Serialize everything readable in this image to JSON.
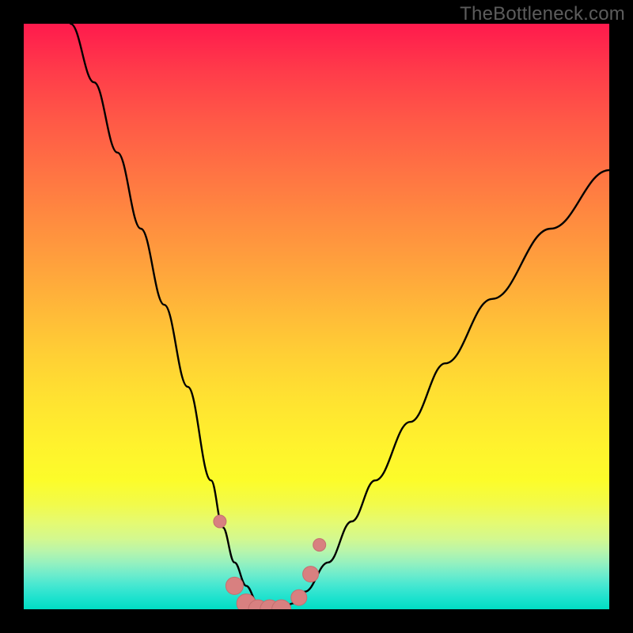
{
  "watermark": {
    "text": "TheBottleneck.com"
  },
  "colors": {
    "frame_bg": "#000000",
    "curve": "#000000",
    "marker_fill": "#d88080",
    "marker_stroke": "#c46f6f"
  },
  "chart_data": {
    "type": "line",
    "title": "",
    "xlabel": "",
    "ylabel": "",
    "xlim": [
      0,
      100
    ],
    "ylim": [
      0,
      100
    ],
    "grid": false,
    "axes_visible": false,
    "note": "V-shaped bottleneck curve with optimum near x≈42; values estimated from pixel positions (no tick labels present).",
    "series": [
      {
        "name": "bottleneck-curve",
        "x": [
          8,
          12,
          16,
          20,
          24,
          28,
          32,
          34,
          36,
          38,
          40,
          42,
          44,
          46,
          48,
          52,
          56,
          60,
          66,
          72,
          80,
          90,
          100
        ],
        "y": [
          100,
          90,
          78,
          65,
          52,
          38,
          22,
          14,
          8,
          4,
          1,
          0,
          0,
          1,
          3,
          8,
          15,
          22,
          32,
          42,
          53,
          65,
          75
        ]
      }
    ],
    "markers": {
      "name": "highlighted-range",
      "shape": "circle",
      "x": [
        33.5,
        36,
        38,
        40,
        42,
        44,
        47,
        49,
        50.5
      ],
      "y": [
        15,
        4,
        1,
        0,
        0,
        0,
        2,
        6,
        11
      ],
      "sizes": [
        8,
        11,
        12,
        12,
        12,
        12,
        10,
        10,
        8
      ]
    }
  }
}
